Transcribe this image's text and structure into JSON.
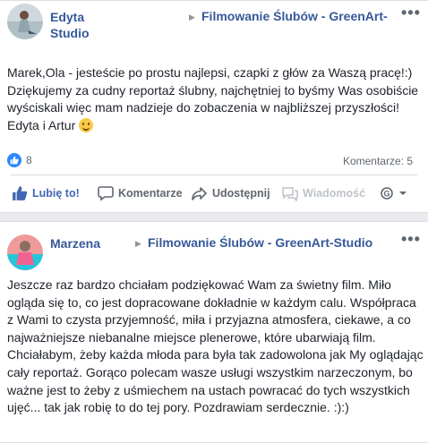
{
  "posts": [
    {
      "author": "Edyta Studio",
      "author_line1": "Edyta",
      "author_line2": "Studio",
      "target_page": "Filmowanie Ślubów - GreenArt-",
      "more_label": "•••",
      "body": "Marek,Ola - jesteście po prostu najlepsi, czapki z głów za Waszą pracę!:) Dziękujemy za cudny reportaż ślubny, najchętniej to byśmy Was osobiście wyściskali więc mam nadzieje do zobaczenia w najbliższej przyszłości! Edyta i Artur",
      "emoji_icon": "smiling-face",
      "like_count": "8",
      "comments_count": "Komentarze: 5",
      "actions": {
        "like": "Lubię to!",
        "comment": "Komentarze",
        "share": "Udostępnij",
        "message": "Wiadomość"
      }
    },
    {
      "author": "Marzena",
      "target_page": "Filmowanie Ślubów - GreenArt-Studio",
      "more_label": "•••",
      "body": "Jeszcze raz bardzo chciałam podziękować Wam za świetny film. Miło ogląda się to, co jest dopracowane dokładnie w każdym calu. Współpraca z Wami to czysta przyjemność, miła i przyjazna atmosfera, ciekawe, a co najważniejsze niebanalne miejsce plenerowe, które ubarwiają film. Chciałabym, żeby każda młoda para była tak zadowolona jak My oglądając cały reportaż. Gorąco polecam wasze usługi wszystkim narzeczonym, bo ważne jest to żeby z uśmiechem na ustach powracać do tych wszystkich ujęć... tak jak robię to do tej pory. Pozdrawiam serdecznie. :):)"
    }
  ],
  "colors": {
    "link": "#365899",
    "like_blue": "#4267b2",
    "text": "#1d2129",
    "muted": "#606770",
    "disabled": "#bec3c9"
  }
}
